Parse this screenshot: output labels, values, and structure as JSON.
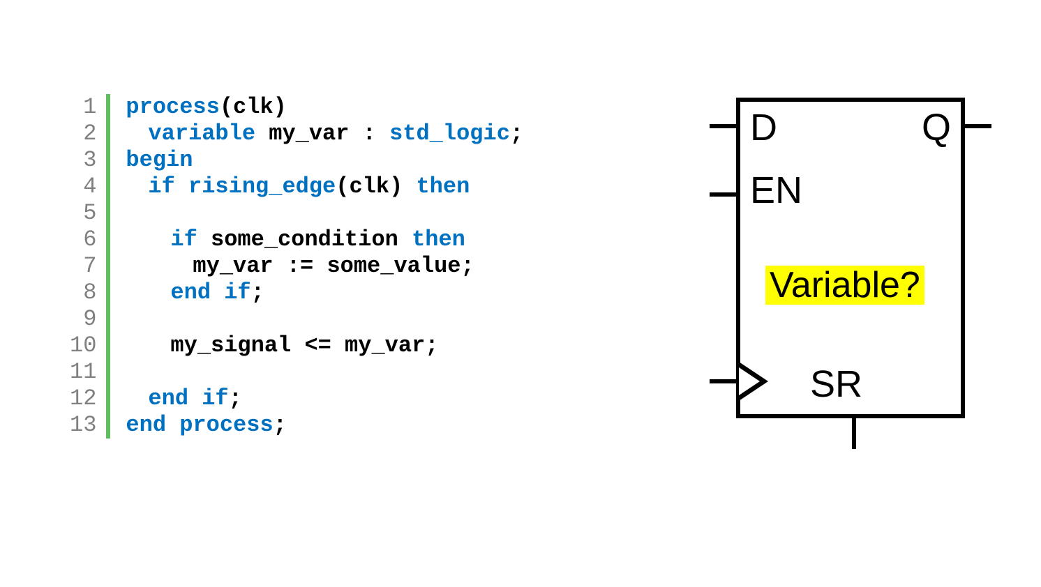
{
  "code": {
    "line_numbers": [
      "1",
      "2",
      "3",
      "4",
      "5",
      "6",
      "7",
      "8",
      "9",
      "10",
      "11",
      "12",
      "13"
    ],
    "l1_kw_process": "process",
    "l1_paren_open": "(",
    "l1_clk": "clk",
    "l1_paren_close": ")",
    "l2_kw_variable": "variable",
    "l2_name": " my_var : ",
    "l2_type": "std_logic",
    "l2_semi": ";",
    "l3_kw_begin": "begin",
    "l4_kw_if": "if",
    "l4_sp1": " ",
    "l4_fn_rising": "rising_edge",
    "l4_args": "(clk) ",
    "l4_kw_then": "then",
    "l6_kw_if": "if",
    "l6_cond": " some_condition ",
    "l6_kw_then": "then",
    "l7_stmt": "my_var := some_value;",
    "l8_end_if": "end if",
    "l8_semi": ";",
    "l10_stmt": "my_signal <= my_var;",
    "l12_end_if": "end if",
    "l12_semi": ";",
    "l13_end_process": "end process",
    "l13_semi": ";"
  },
  "diagram": {
    "pin_d": "D",
    "pin_q": "Q",
    "pin_en": "EN",
    "pin_sr": "SR",
    "variable_label": "Variable?"
  }
}
